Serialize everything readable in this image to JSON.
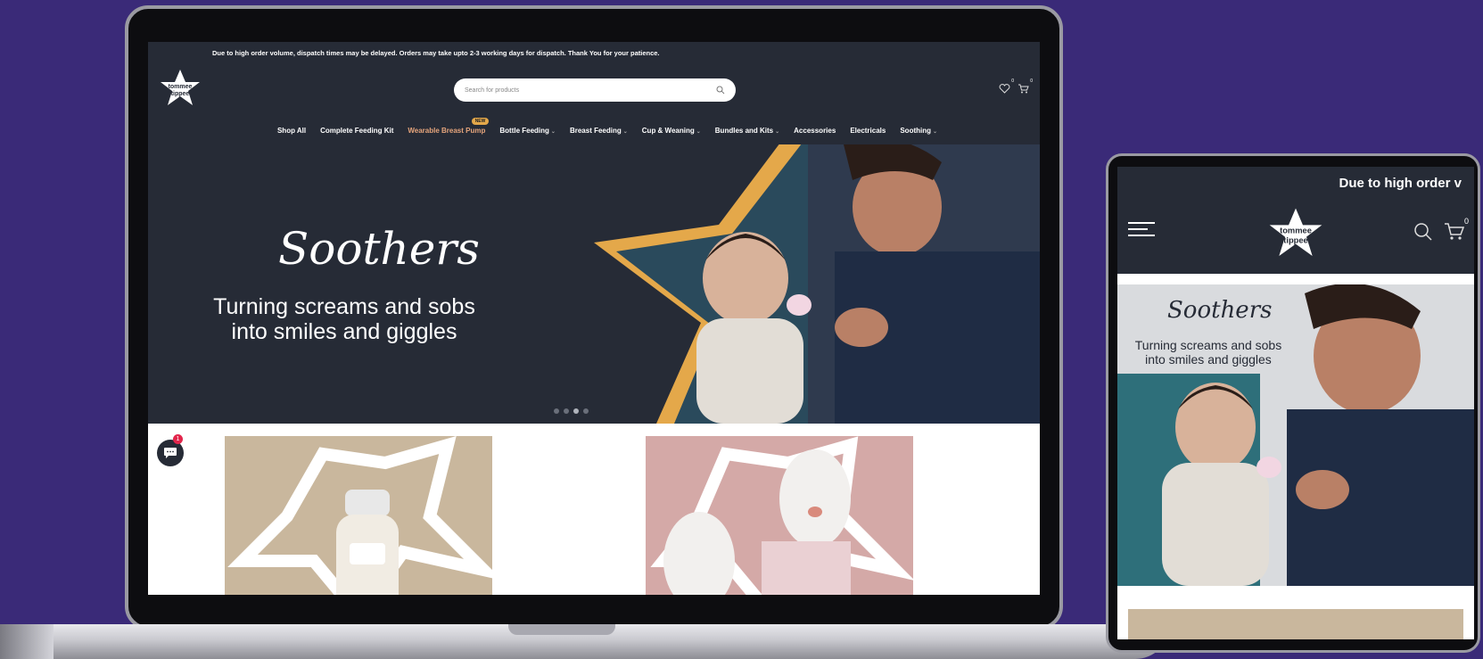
{
  "laptop": {
    "announcement": "Due to high order volume, dispatch times may be delayed. Orders may take upto 2-3 working days for dispatch. Thank You for your patience.",
    "logo_text_top": "tommee",
    "logo_text_bottom": "tippee",
    "search": {
      "placeholder": "Search for products"
    },
    "header_icons": {
      "wishlist_count": "0",
      "cart_count": "0"
    },
    "nav": {
      "items": [
        {
          "label": "Shop All",
          "has_caret": false
        },
        {
          "label": "Complete Feeding Kit",
          "has_caret": false
        },
        {
          "label": "Wearable Breast Pump",
          "has_caret": false,
          "highlight": true,
          "badge": "NEW"
        },
        {
          "label": "Bottle Feeding",
          "has_caret": true
        },
        {
          "label": "Breast Feeding",
          "has_caret": true
        },
        {
          "label": "Cup & Weaning",
          "has_caret": true
        },
        {
          "label": "Bundles and Kits",
          "has_caret": true
        },
        {
          "label": "Accessories",
          "has_caret": false
        },
        {
          "label": "Electricals",
          "has_caret": false
        },
        {
          "label": "Soothing",
          "has_caret": true
        }
      ]
    },
    "hero": {
      "title": "Soothers",
      "subtitle_line1": "Turning screams and sobs",
      "subtitle_line2": "into smiles and giggles",
      "active_slide": 3,
      "slide_count": 4
    },
    "chat": {
      "badge_count": "1"
    }
  },
  "tablet": {
    "announcement": "Due to high order v",
    "logo_text_top": "tommee",
    "logo_text_bottom": "tippee",
    "header_icons": {
      "cart_count": "0"
    },
    "hero": {
      "title": "Soothers",
      "subtitle_line1": "Turning screams and sobs",
      "subtitle_line2": "into smiles and giggles"
    }
  },
  "colors": {
    "background": "#3a2a78",
    "header_bg": "#262b36",
    "accent_gold": "#e4a84a",
    "highlight_nav": "#e6a57c"
  }
}
